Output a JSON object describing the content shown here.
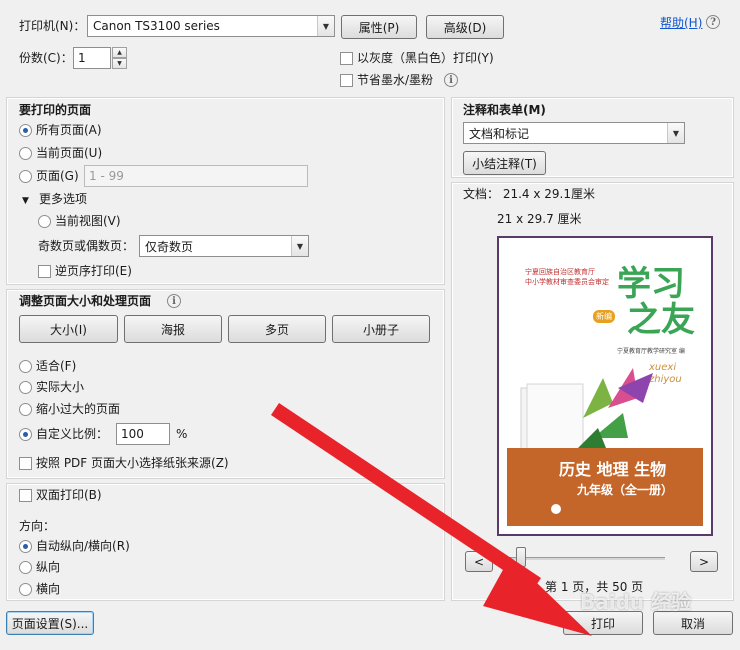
{
  "printer": {
    "label": "打印机(N)：",
    "selected": "Canon TS3100 series",
    "properties_label": "属性(P)",
    "advanced_label": "高级(D)",
    "help_label": "帮助(H)"
  },
  "copies": {
    "label": "份数(C)：",
    "value": "1"
  },
  "options": {
    "grayscale_label": "以灰度（黑白色）打印(Y)",
    "save_ink_label": "节省墨水/墨粉"
  },
  "pages_to_print": {
    "title": "要打印的页面",
    "all_pages": "所有页面(A)",
    "current_page": "当前页面(U)",
    "pages_label": "页面(G)",
    "pages_placeholder": "1 - 99",
    "more_options": "更多选项",
    "current_view": "当前视图(V)",
    "odd_even_label": "奇数页或偶数页：",
    "odd_even_selected": "仅奇数页",
    "reverse_order": "逆页序打印(E)"
  },
  "sizing": {
    "title": "调整页面大小和处理页面",
    "btn_size": "大小(I)",
    "btn_poster": "海报",
    "btn_multiple": "多页",
    "btn_booklet": "小册子",
    "fit": "适合(F)",
    "actual_size": "实际大小",
    "shrink_oversized": "缩小过大的页面",
    "custom_scale_label": "自定义比例：",
    "custom_scale_value": "100",
    "percent": "%",
    "choose_paper_source": "按照 PDF 页面大小选择纸张来源(Z)"
  },
  "duplex": {
    "label": "双面打印(B)"
  },
  "orientation": {
    "title": "方向：",
    "auto": "自动纵向/横向(R)",
    "portrait": "纵向",
    "landscape": "横向"
  },
  "comments": {
    "title": "注释和表单(M)",
    "selected": "文档和标记",
    "summarize_label": "小结注释(T)"
  },
  "preview": {
    "doc_size": "文档：  21.4 x 29.1厘米",
    "paper_size": "21 x 29.7 厘米",
    "page_info": "第 1 页，共 50 页",
    "prev": "<",
    "next": ">"
  },
  "cover": {
    "publisher_line1": "宁夏回族自治区教育厅",
    "publisher_line2": "中小学教材审查委员会审定",
    "title_line1": "学习",
    "title_line2": "之友",
    "new_edition": "新编",
    "pinyin1": "xuexi",
    "pinyin2": "zhiyou",
    "editor": "宁夏教育厅教学研究室  编",
    "subjects": "历史 地理 生物",
    "grade": "九年级（全一册）"
  },
  "footer": {
    "page_setup_label": "页面设置(S)...",
    "print_label": "打印",
    "cancel_label": "取消"
  },
  "watermark": {
    "text": "Baidu 经验"
  },
  "colors": {
    "arrow": "#e8242a",
    "cover_brown": "#c4652a",
    "cover_green": "#3aa655",
    "link": "#1155cc"
  }
}
